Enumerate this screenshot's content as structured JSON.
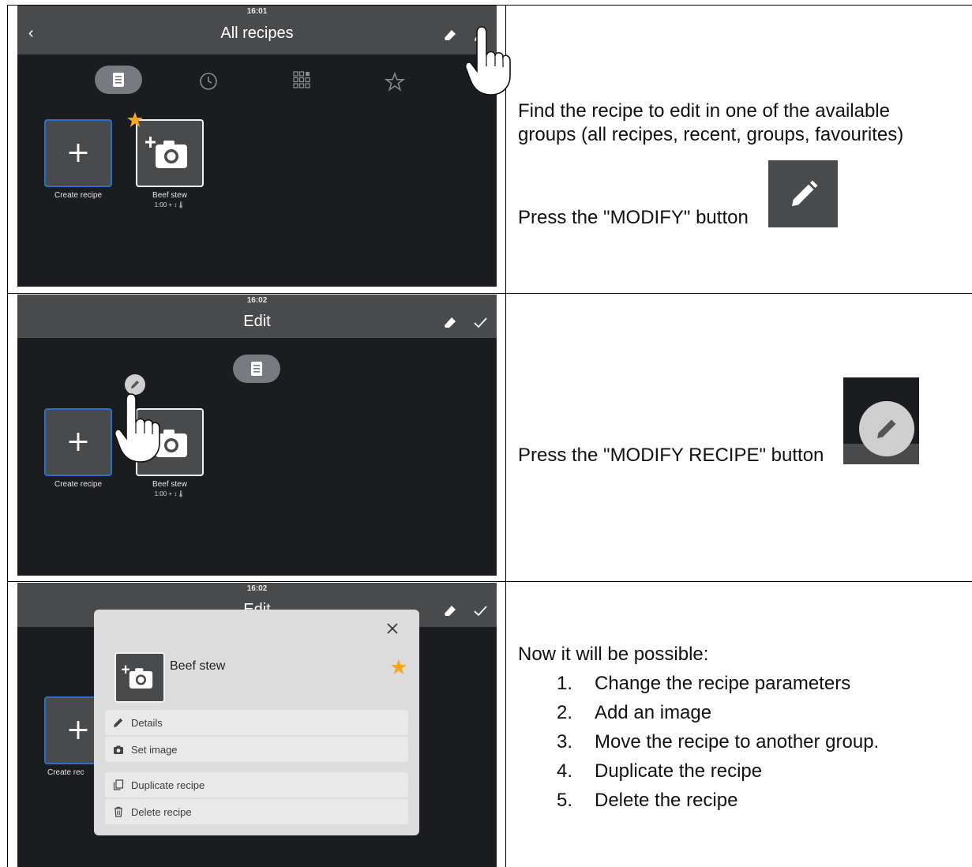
{
  "row1": {
    "screen": {
      "clock": "16:01",
      "title": "All recipes",
      "tiles": {
        "create_label": "Create recipe",
        "recipe_label": "Beef stew",
        "recipe_sub": "1:00 + ↕🌡"
      }
    },
    "instruction_line1": "Find the recipe to edit in one of the available",
    "instruction_line2": "groups (all recipes, recent, groups, favourites)",
    "press_text": "Press the \"MODIFY\" button"
  },
  "row2": {
    "screen": {
      "clock": "16:02",
      "title": "Edit",
      "tiles": {
        "create_label": "Create recipe",
        "recipe_label": "Beef stew",
        "recipe_sub": "1:00 + ↕🌡"
      }
    },
    "press_text": "Press the \"MODIFY RECIPE\" button"
  },
  "row3": {
    "screen": {
      "clock": "16:02",
      "title": "Edit",
      "create_label_partial": "Create rec",
      "dialog": {
        "recipe_name": "Beef stew",
        "items": [
          "Details",
          "Set image",
          "Duplicate recipe",
          "Delete recipe"
        ]
      }
    },
    "intro": "Now it will be possible:",
    "steps": [
      {
        "num": "1.",
        "text": "Change the recipe parameters"
      },
      {
        "num": "2.",
        "text": "Add an image"
      },
      {
        "num": "3.",
        "text": "Move the recipe to another group."
      },
      {
        "num": "4.",
        "text": "Duplicate the recipe"
      },
      {
        "num": "5.",
        "text": "Delete the recipe"
      }
    ]
  },
  "colors": {
    "header_gray": "#494a4c",
    "screen_bg": "#1b1c20",
    "create_border": "#2b6fc9",
    "star": "#f5a623"
  }
}
